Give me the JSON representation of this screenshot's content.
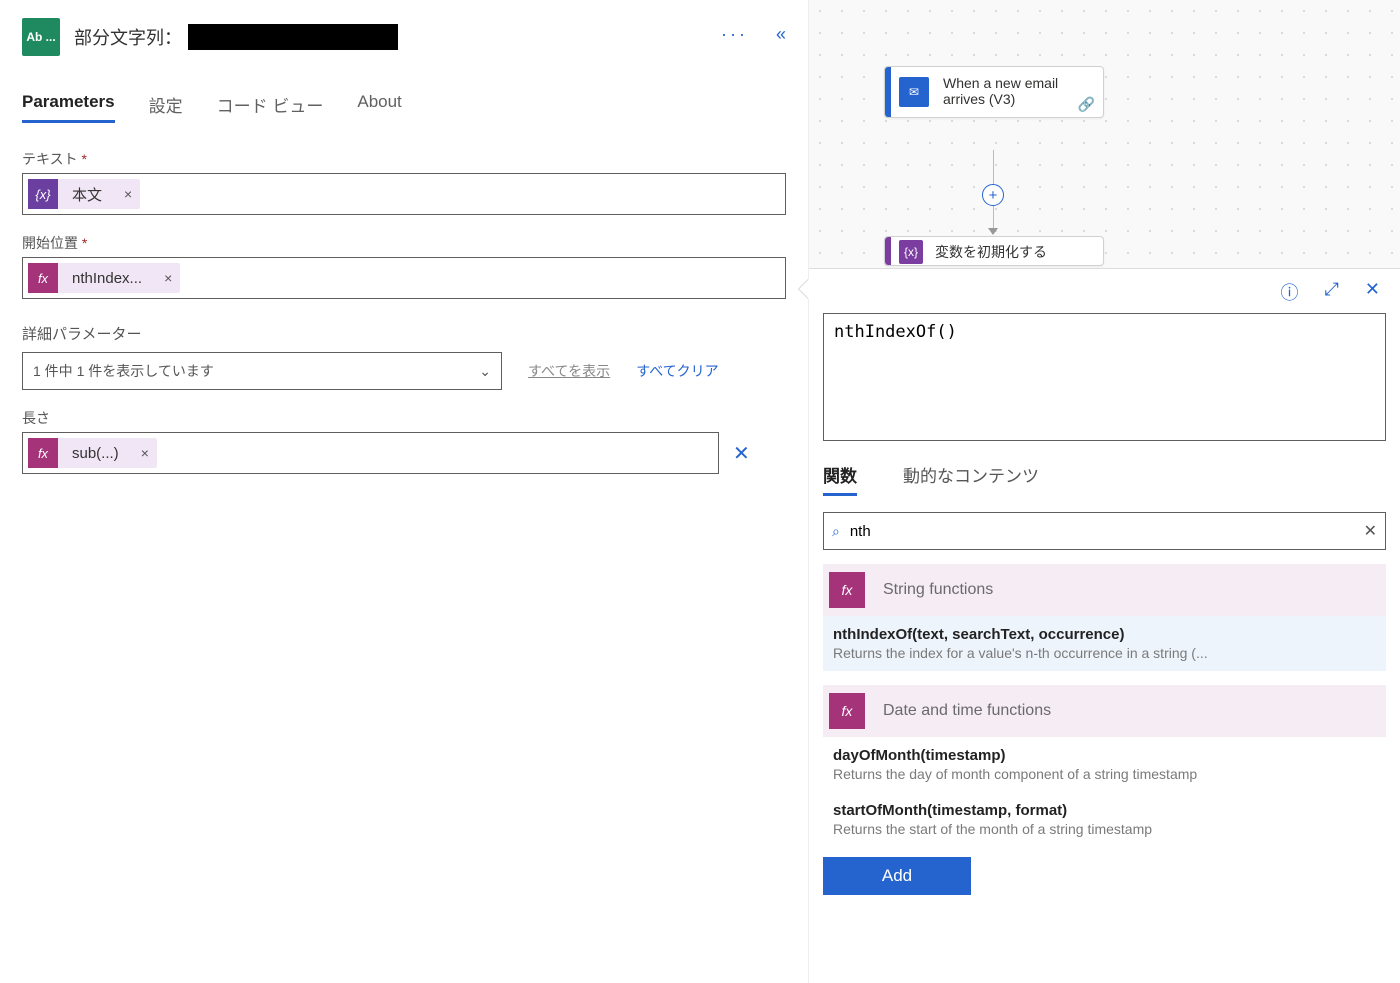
{
  "header": {
    "badge": "Ab ...",
    "title_prefix": "部分文字列："
  },
  "tabs": [
    "Parameters",
    "設定",
    "コード ビュー",
    "About"
  ],
  "fields": {
    "text_label": "テキスト",
    "text_token": "本文",
    "start_label": "開始位置",
    "start_token": "nthIndex...",
    "adv_title": "詳細パラメーター",
    "adv_select": "1 件中 1 件を表示しています",
    "show_all": "すべてを表示",
    "clear_all": "すべてクリア",
    "length_label": "長さ",
    "length_token": "sub(...)"
  },
  "flow": {
    "card1": "When a new email arrives (V3)",
    "card2": "変数を初期化する"
  },
  "popup": {
    "expr": "nthIndexOf()",
    "tabs": [
      "関数",
      "動的なコンテンツ"
    ],
    "search": "nth",
    "cat1": "String functions",
    "cat2": "Date and time functions",
    "items": [
      {
        "sig": "nthIndexOf(text, searchText, occurrence)",
        "desc": "Returns the index for a value's n-th occurrence in a string (..."
      },
      {
        "sig": "dayOfMonth(timestamp)",
        "desc": "Returns the day of month component of a string timestamp"
      },
      {
        "sig": "startOfMonth(timestamp, format)",
        "desc": "Returns the start of the month of a string timestamp"
      }
    ],
    "add": "Add"
  }
}
